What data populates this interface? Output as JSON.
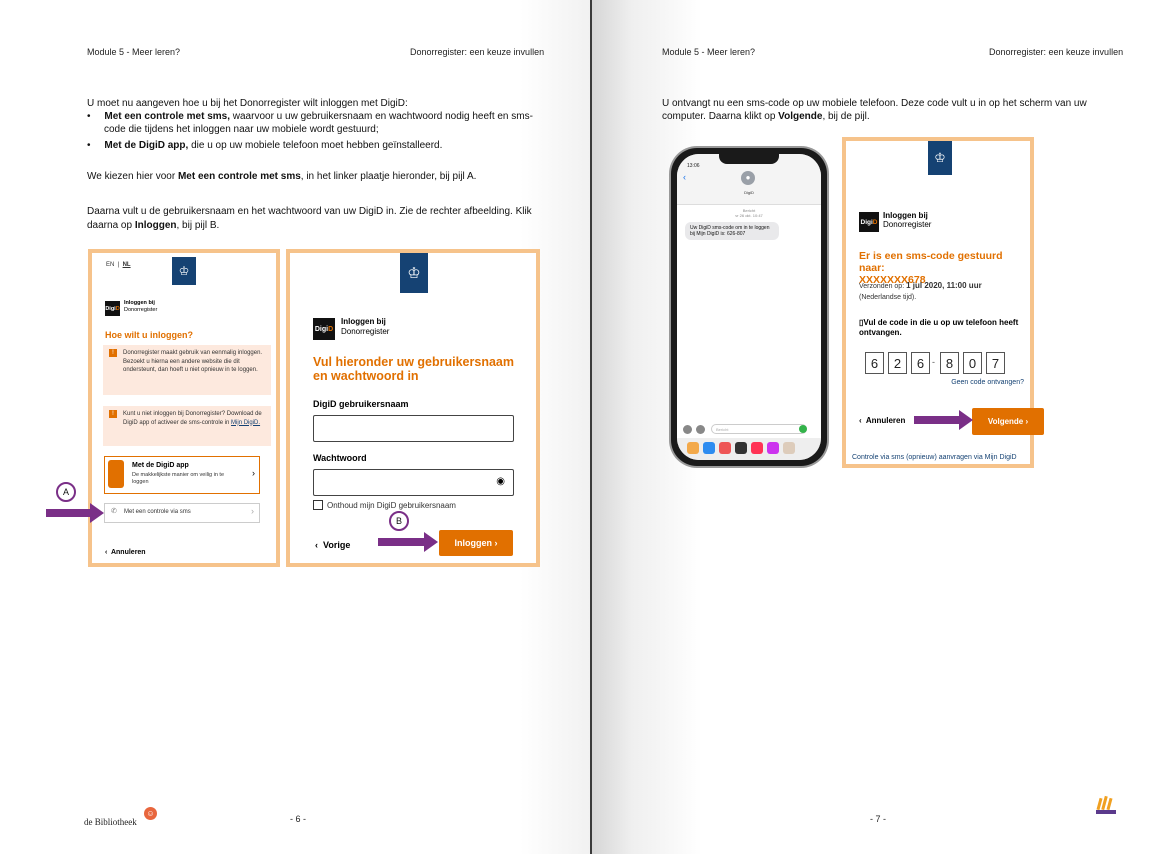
{
  "left_page": {
    "header_left": "Module 5 - Meer leren?",
    "header_right": "Donorregister: een keuze invullen",
    "intro": "U moet nu aangeven hoe u bij het Donorregister wilt inloggen met DigiD:",
    "bullets": [
      {
        "bold": "Met een controle met sms,",
        "line1": " waarvoor u uw gebruikersnaam en wachtwoord nodig heeft en sms-",
        "line2": "code die tijdens het inloggen naar uw mobiele wordt gestuurd;"
      },
      {
        "bold": "Met de DigiD app,",
        "line1": " die u op uw mobiele telefoon moet hebben geïnstalleerd.",
        "line2": ""
      }
    ],
    "p2_prefix": "We kiezen hier voor ",
    "p2_bold": "Met een controle met sms",
    "p2_suffix": ", in het linker plaatje hieronder, bij pijl A.",
    "p3_line1": "Daarna vult u de gebruikersnaam en het wachtwoord van uw DigiD in. Zie de rechter afbeelding. Klik",
    "p3_prefix": "daarna op ",
    "p3_bold": "Inloggen",
    "p3_suffix": ", bij pijl B.",
    "page_number": "- 6 -",
    "footer_logo": "de Bibliotheek",
    "shot1": {
      "lang_en": "EN",
      "lang_nl": "NL",
      "logo_line1": "Inloggen bij",
      "logo_line2": "Donorregister",
      "heading": "Hoe wilt u inloggen?",
      "info1": "Donorregister maakt gebruik van eenmalig inloggen. Bezoekt u hierna een andere website die dit ondersteunt, dan hoeft u niet opnieuw in te loggen.",
      "info2_text": "Kunt u niet inloggen bij Donorregister? Download de DigiD app of activeer de sms-controle in ",
      "info2_link": "Mijn DigiD.",
      "app_title": "Met de DigiD app",
      "app_sub": "De makkelijkste manier om veilig in te loggen",
      "sms_option": "Met een controle via sms",
      "cancel": "Annuleren",
      "marker": "A"
    },
    "shot2": {
      "logo_line1": "Inloggen bij",
      "logo_line2": "Donorregister",
      "heading": "Vul hieronder uw gebruikersnaam en wachtwoord in",
      "user_label": "DigiD gebruikersnaam",
      "pass_label": "Wachtwoord",
      "remember": "Onthoud mijn DigiD gebruikersnaam",
      "back": "Vorige",
      "login": "Inloggen",
      "marker": "B"
    }
  },
  "right_page": {
    "header_left": "Module 5 - Meer leren?",
    "header_right": "Donorregister: een keuze invullen",
    "p1_line1": "U ontvangt nu een sms-code op uw mobiele telefoon. Deze code vult u in op het scherm van uw",
    "p1_prefix": "computer. Daarna klikt op ",
    "p1_bold": "Volgende",
    "p1_suffix": ", bij de pijl.",
    "page_number": "- 7 -",
    "phone": {
      "time": "13:06",
      "contact": "DigiD",
      "stamp1": "Bericht",
      "stamp2": "vr 26 okt. 10:47",
      "message": "Uw DigiD sms-code om in te loggen bij Mijn DigiD is: 626-807",
      "input_placeholder": "Bericht"
    },
    "shot3": {
      "logo_line1": "Inloggen bij",
      "logo_line2": "Donorregister",
      "heading_line1": "Er is een sms-code gestuurd naar:",
      "heading_line2": "XXXXXXX678",
      "sent_label": "Verzonden op: ",
      "sent_value": "1 jul 2020, 11:00 uur",
      "tz": "(Nederlandse tijd).",
      "instruction": "Vul de code in die u op uw telefoon heeft ontvangen.",
      "code_digits": [
        "6",
        "2",
        "6",
        "8",
        "0",
        "7"
      ],
      "no_code": "Geen code ontvangen?",
      "cancel": "Annuleren",
      "next": "Volgende",
      "bottom_link": "Controle via sms (opnieuw) aanvragen via Mijn DigiD"
    }
  },
  "colors": {
    "orange": "#e17000",
    "frame": "#f6c38b",
    "arrow": "#7a2f87",
    "rijk_blue": "#154273"
  }
}
